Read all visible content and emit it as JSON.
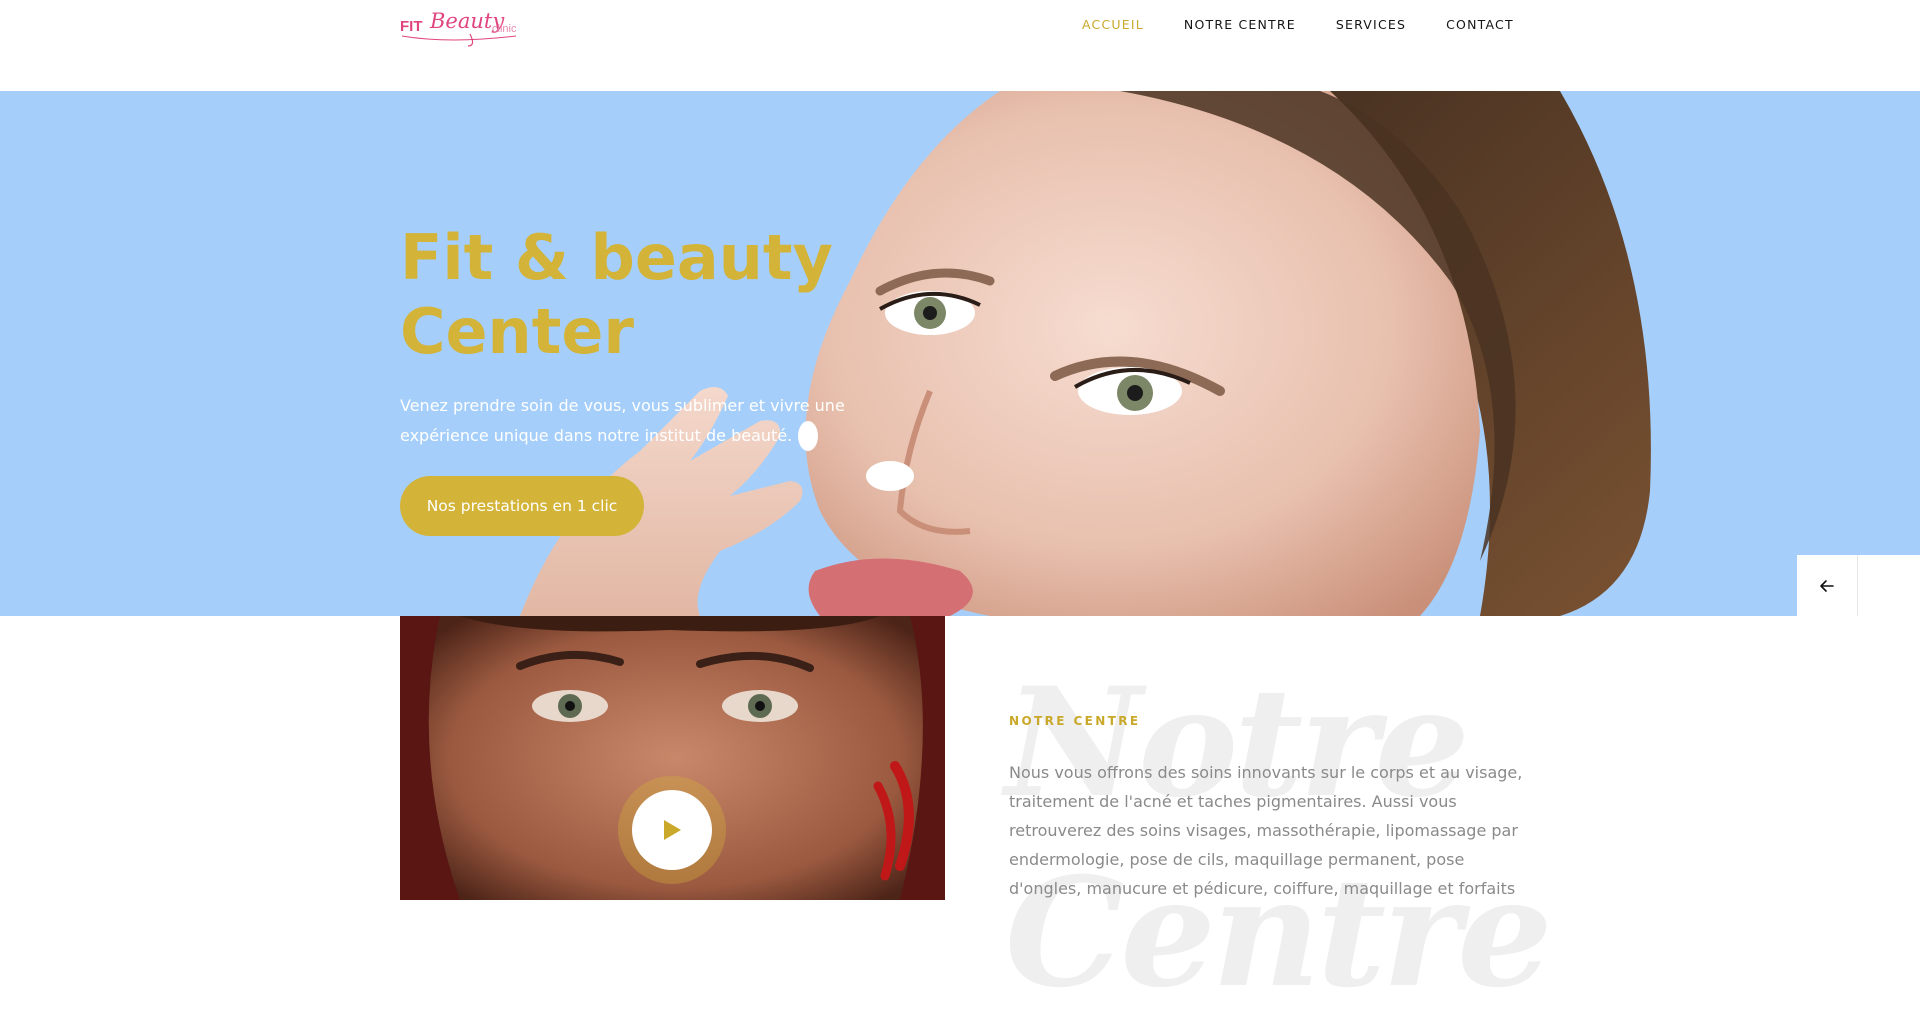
{
  "header": {
    "logo_alt": "Fit & Beauty Clinic",
    "nav": [
      {
        "label": "ACCUEIL",
        "active": true
      },
      {
        "label": "NOTRE CENTRE",
        "active": false
      },
      {
        "label": "SERVICES",
        "active": false
      },
      {
        "label": "CONTACT",
        "active": false
      }
    ]
  },
  "hero": {
    "title": "Fit & beauty Center",
    "subtitle": "Venez prendre soin de vous, vous sublimer et vivre une expérience unique dans notre institut de beauté.",
    "cta_label": "Nos prestations en 1 clic",
    "prev_icon": "arrow-left-icon"
  },
  "about": {
    "video_icon": "play-icon",
    "watermark": "Notre Centre",
    "eyebrow": "NOTRE CENTRE",
    "text": "Nous vous offrons des soins innovants sur le corps et au visage, traitement de l'acné et taches pigmentaires. Aussi vous retrouverez des soins visages, massothérapie, lipomassage par endermologie, pose de cils, maquillage permanent, pose d'ongles, manucure et pédicure, coiffure, maquillage et forfaits"
  },
  "colors": {
    "accent_gold": "#d3b338",
    "hero_background": "#a5cffa",
    "logo_pink": "#e0457f",
    "body_text": "#8a8a8a"
  }
}
